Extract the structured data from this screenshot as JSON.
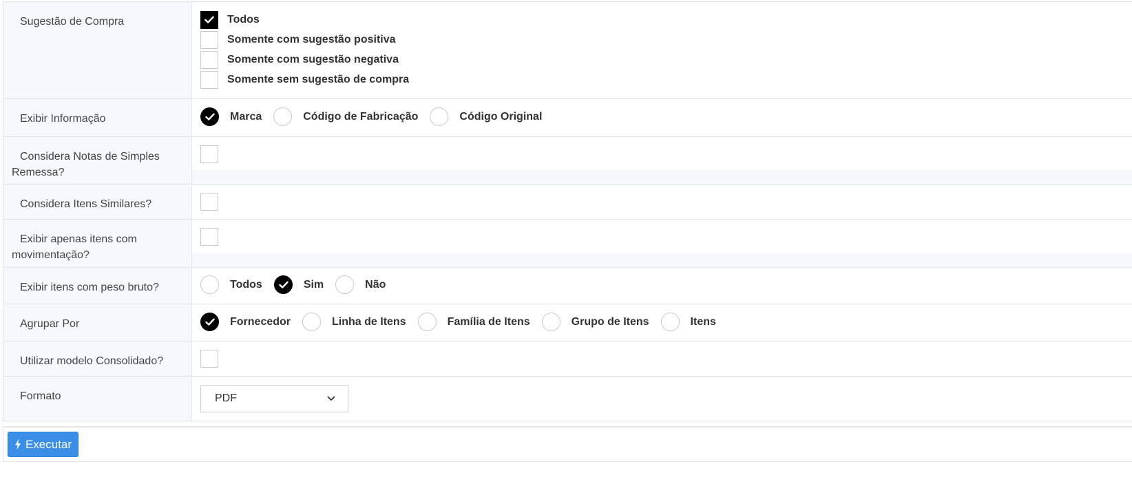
{
  "rows": {
    "sugestao": {
      "label": "Sugestão de Compra",
      "options": [
        {
          "label": "Todos",
          "checked": true
        },
        {
          "label": "Somente com sugestão positiva",
          "checked": false
        },
        {
          "label": "Somente com sugestão negativa",
          "checked": false
        },
        {
          "label": "Somente sem sugestão de compra",
          "checked": false
        }
      ]
    },
    "exibir_info": {
      "label": "Exibir Informação",
      "options": [
        {
          "label": "Marca",
          "checked": true
        },
        {
          "label": "Código de Fabricação",
          "checked": false
        },
        {
          "label": "Código Original",
          "checked": false
        }
      ]
    },
    "notas_simples": {
      "label_line1": "Considera Notas de Simples",
      "label_line2": "Remessa?",
      "checked": false
    },
    "itens_similares": {
      "label": "Considera Itens Similares?",
      "checked": false
    },
    "apenas_movimentacao": {
      "label_line1": "Exibir apenas itens com",
      "label_line2": "movimentação?",
      "checked": false
    },
    "peso_bruto": {
      "label": "Exibir itens com peso bruto?",
      "options": [
        {
          "label": "Todos",
          "checked": false
        },
        {
          "label": "Sim",
          "checked": true
        },
        {
          "label": "Não",
          "checked": false
        }
      ]
    },
    "agrupar": {
      "label": "Agrupar Por",
      "options": [
        {
          "label": "Fornecedor",
          "checked": true
        },
        {
          "label": "Linha de Itens",
          "checked": false
        },
        {
          "label": "Família de Itens",
          "checked": false
        },
        {
          "label": "Grupo de Itens",
          "checked": false
        },
        {
          "label": "Itens",
          "checked": false
        }
      ]
    },
    "consolidado": {
      "label": "Utilizar modelo Consolidado?",
      "checked": false
    },
    "formato": {
      "label": "Formato",
      "selected": "PDF"
    }
  },
  "actions": {
    "execute_label": "Executar"
  },
  "colors": {
    "accent": "#3a8ee6",
    "label_bg": "#f5f9fd",
    "border": "#dfe3e8",
    "checked": "#000000"
  },
  "icons": {
    "execute": "bolt-icon",
    "select": "chevron-down-icon",
    "check": "check-icon"
  }
}
